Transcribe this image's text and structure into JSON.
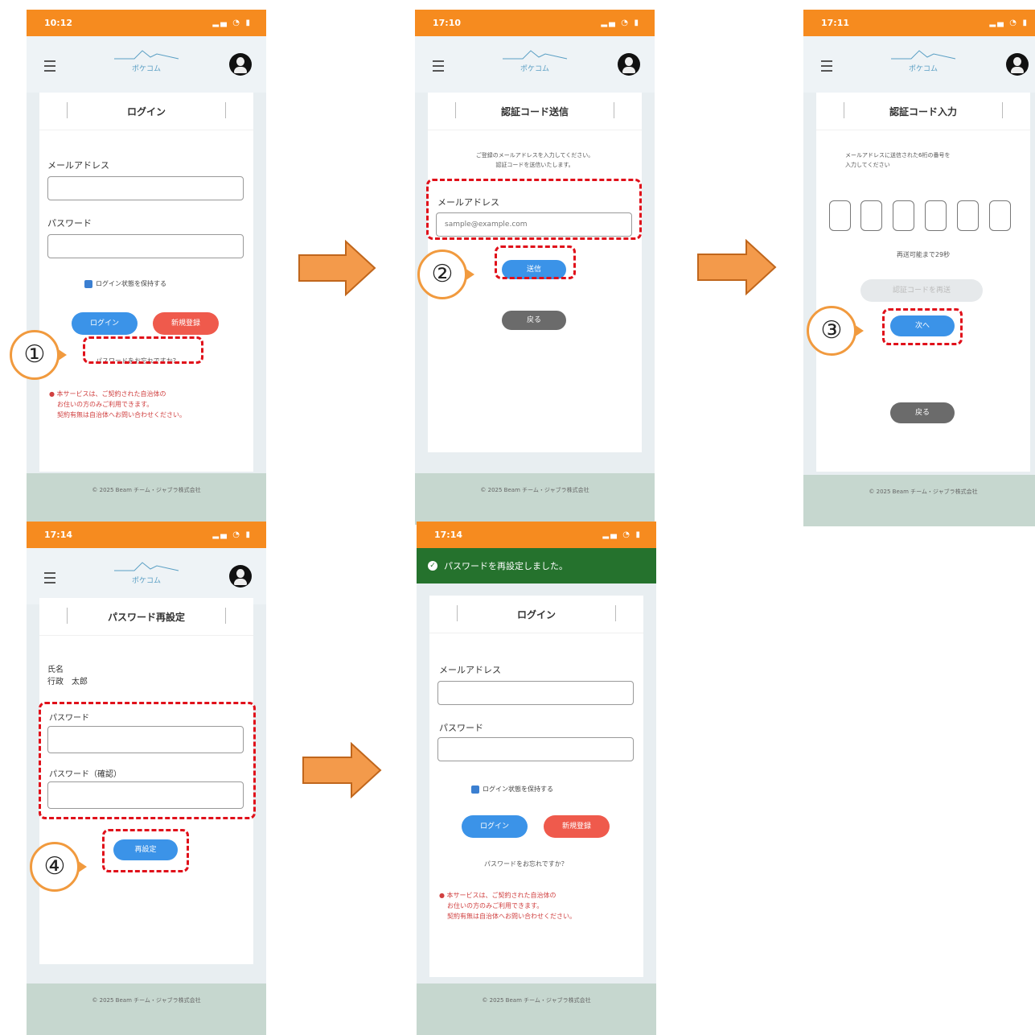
{
  "app": {
    "logo_text": "ポケコム",
    "footer": "© 2025 Beam チーム・ジャブラ株式会社"
  },
  "login": {
    "title": "ログイン",
    "email_label": "メールアドレス",
    "password_label": "パスワード",
    "remember_label": "ログイン状態を保持する",
    "login_button": "ログイン",
    "signup_button": "新規登録",
    "forgot_link": "パスワードをお忘れですか？",
    "notes": [
      "● 本サービスは、ご契約された自治体の",
      "お住いの方のみご利用できます。",
      "契約有無は自治体へお問い合わせください。"
    ]
  },
  "screens": [
    {
      "time": "10:12"
    },
    {
      "time": "17:10",
      "title": "認証コード送信",
      "instruction": [
        "ご登録のメールアドレスを入力してください。",
        "認証コードを送信いたします。"
      ],
      "email_label": "メールアドレス",
      "email_placeholder": "sample@example.com",
      "send_button": "送信",
      "back_button": "戻る"
    },
    {
      "time": "17:11",
      "title": "認証コード入力",
      "instruction": [
        "メールアドレスに送信された6桁の番号を",
        "入力してください"
      ],
      "resend_text": "再送可能まで29秒",
      "resend_button": "認証コードを再送",
      "next_button": "次へ",
      "back_button": "戻る"
    },
    {
      "time": "17:14",
      "title": "パスワード再設定",
      "name_label": "氏名",
      "name_value": "行政　太郎",
      "password_label": "パスワード",
      "confirm_label": "パスワード（確認）",
      "reset_button": "再設定"
    },
    {
      "time": "17:14",
      "toast": "パスワードを再設定しました。"
    }
  ],
  "steps": [
    "①",
    "②",
    "③",
    "④"
  ],
  "colors": {
    "status_bar": "#f68b1f",
    "primary": "#3b93e8",
    "danger": "#ef5a4c",
    "highlight": "#e0101a",
    "step_ring": "#f19a3e",
    "toast": "#25722d"
  }
}
